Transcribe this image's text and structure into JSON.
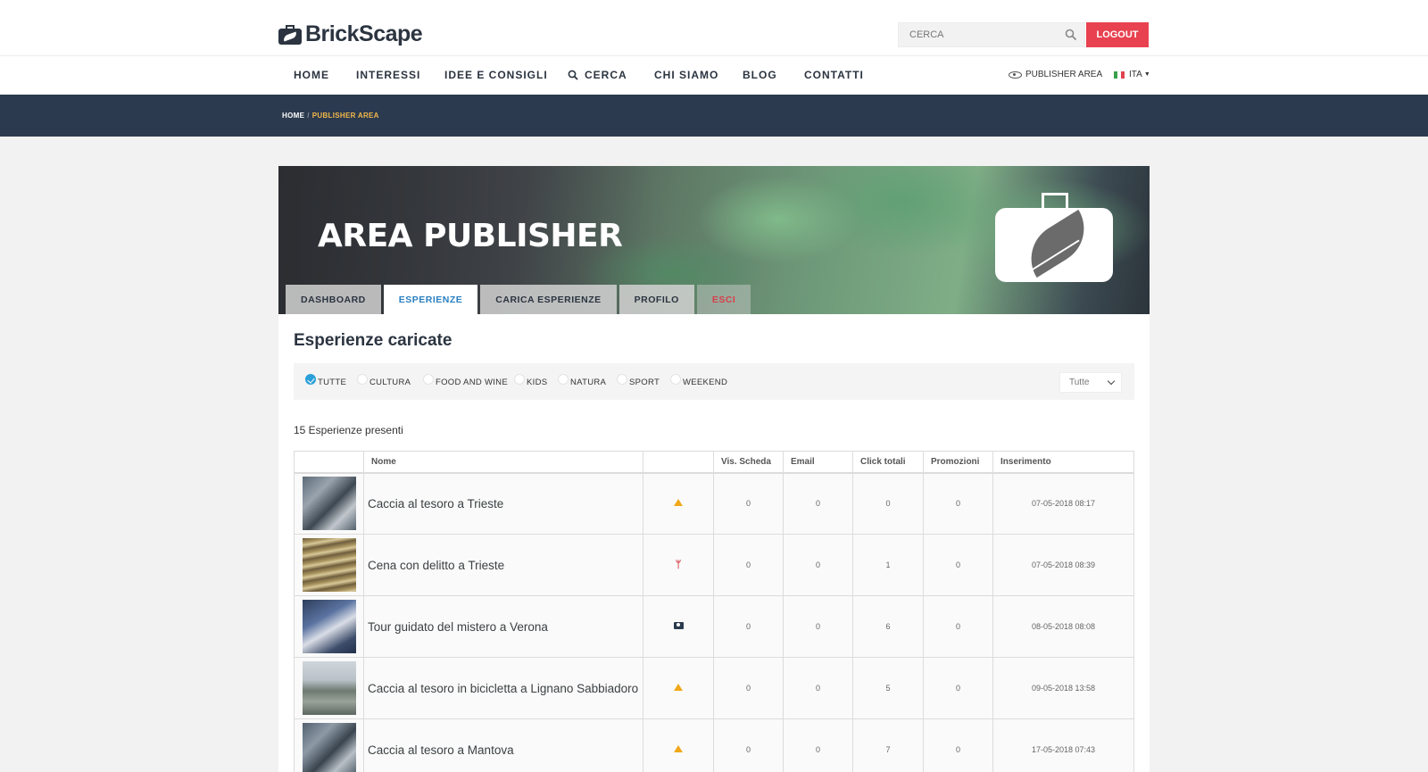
{
  "brand": {
    "name": "BrickScape"
  },
  "search": {
    "placeholder": "CERCA"
  },
  "header": {
    "logout_label": "LOGOUT"
  },
  "nav": {
    "items": [
      "HOME",
      "INTERESSI",
      "IDEE E CONSIGLI",
      "CERCA",
      "CHI SIAMO",
      "BLOG",
      "CONTATTI"
    ],
    "publisher_area": "PUBLISHER AREA",
    "language": "ITA"
  },
  "breadcrumb": {
    "home": "HOME",
    "separator": "/",
    "current": "PUBLISHER AREA"
  },
  "banner": {
    "title": "AREA PUBLISHER",
    "tabs": [
      "DASHBOARD",
      "ESPERIENZE",
      "CARICA ESPERIENZE",
      "PROFILO",
      "ESCI"
    ],
    "active_tab": "ESPERIENZE"
  },
  "main": {
    "title": "Esperienze caricate",
    "filters": [
      "TUTTE",
      "CULTURA",
      "FOOD AND WINE",
      "KIDS",
      "NATURA",
      "SPORT",
      "WEEKEND"
    ],
    "selected_filter": "TUTTE",
    "select_value": "Tutte",
    "count_text": "15 Esperienze presenti"
  },
  "table": {
    "columns": [
      "",
      "Nome",
      "",
      "Vis. Scheda",
      "Email",
      "Click totali",
      "Promozioni",
      "Inserimento"
    ],
    "rows": [
      {
        "name": "Caccia al tesoro a Trieste",
        "icon": "arrow-up-icon",
        "vis": "0",
        "email": "0",
        "click": "0",
        "promo": "0",
        "date": "07-05-2018 08:17"
      },
      {
        "name": "Cena con delitto a Trieste",
        "icon": "fork-knife-icon",
        "vis": "0",
        "email": "0",
        "click": "1",
        "promo": "0",
        "date": "07-05-2018 08:39"
      },
      {
        "name": "Tour guidato del mistero a Verona",
        "icon": "camera-icon",
        "vis": "0",
        "email": "0",
        "click": "6",
        "promo": "0",
        "date": "08-05-2018 08:08"
      },
      {
        "name": "Caccia al tesoro in bicicletta a Lignano Sabbiadoro",
        "icon": "arrow-up-icon",
        "vis": "0",
        "email": "0",
        "click": "5",
        "promo": "0",
        "date": "09-05-2018 13:58"
      },
      {
        "name": "Caccia al tesoro a Mantova",
        "icon": "arrow-up-icon",
        "vis": "0",
        "email": "0",
        "click": "7",
        "promo": "0",
        "date": "17-05-2018 07:43"
      }
    ]
  },
  "colors": {
    "accent_red": "#e8414f",
    "nav_dark": "#2b3a4e",
    "breadcrumb_active": "#f2b84b",
    "tab_active": "#2a7fc1"
  }
}
